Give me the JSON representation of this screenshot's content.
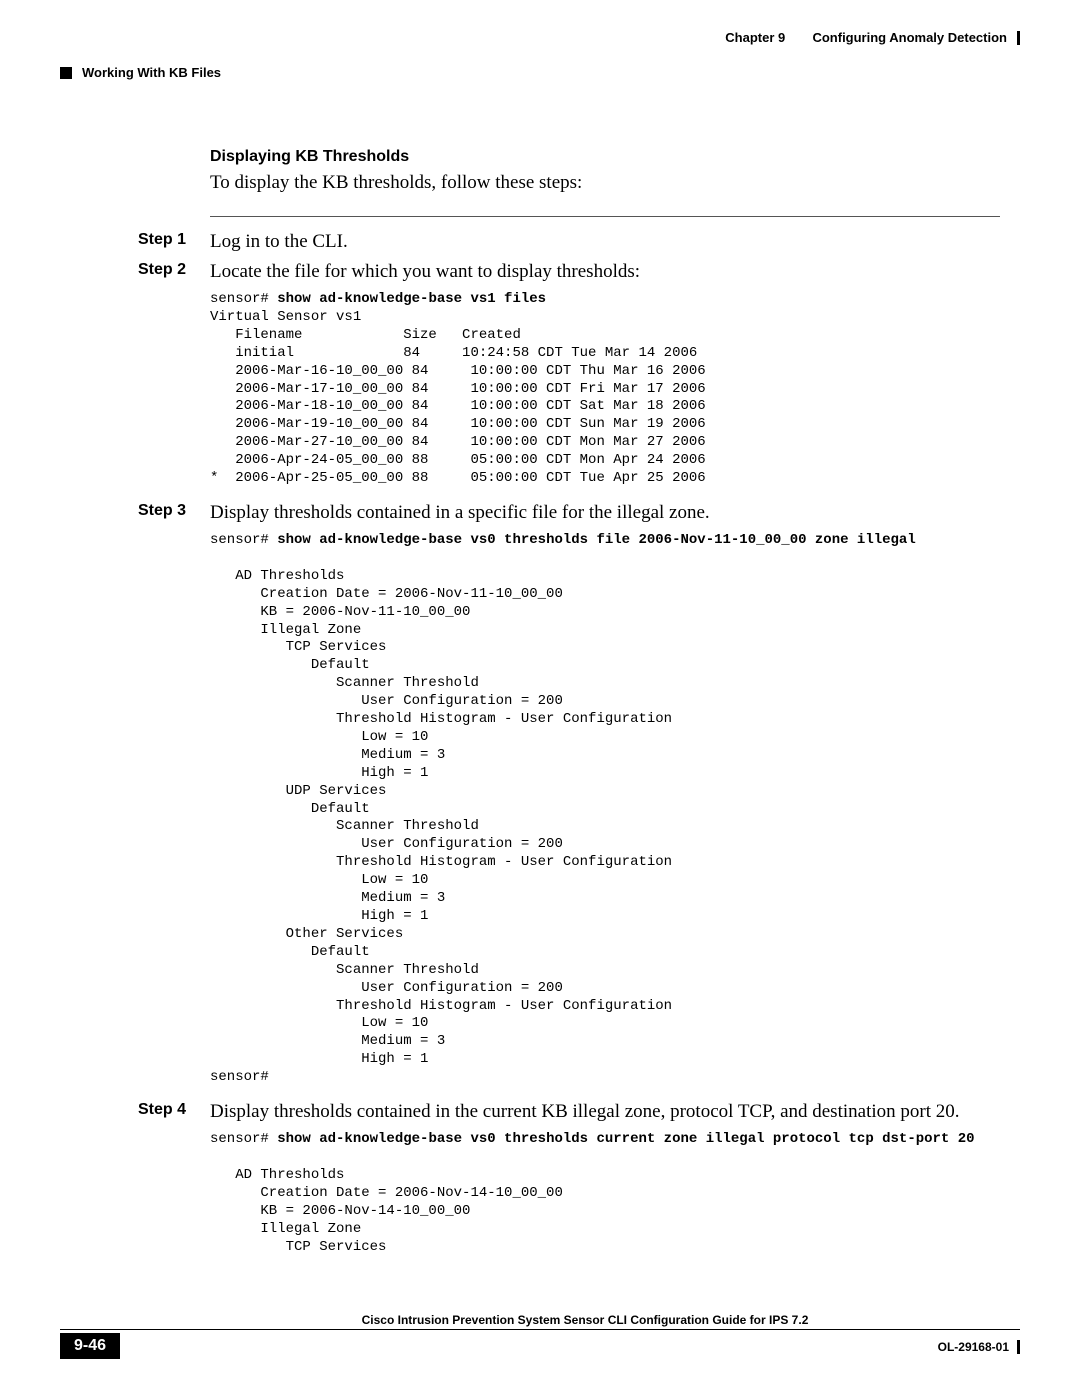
{
  "header": {
    "chapter": "Chapter 9",
    "chapterTitle": "Configuring Anomaly Detection",
    "section": "Working With KB Files"
  },
  "section": {
    "heading": "Displaying KB Thresholds",
    "intro": "To display the KB thresholds, follow these steps:"
  },
  "steps": {
    "s1": {
      "label": "Step 1",
      "text": "Log in to the CLI."
    },
    "s2": {
      "label": "Step 2",
      "text": "Locate the file for which you want to display thresholds:"
    },
    "s3": {
      "label": "Step 3",
      "text": "Display thresholds contained in a specific file for the illegal zone."
    },
    "s4": {
      "label": "Step 4",
      "text": "Display thresholds contained in the current KB illegal zone, protocol TCP, and destination port 20."
    }
  },
  "code": {
    "c2cmd": "show ad-knowledge-base vs1 files",
    "c2out": "Virtual Sensor vs1\n   Filename            Size   Created\n   initial             84     10:24:58 CDT Tue Mar 14 2006\n   2006-Mar-16-10_00_00 84     10:00:00 CDT Thu Mar 16 2006\n   2006-Mar-17-10_00_00 84     10:00:00 CDT Fri Mar 17 2006\n   2006-Mar-18-10_00_00 84     10:00:00 CDT Sat Mar 18 2006\n   2006-Mar-19-10_00_00 84     10:00:00 CDT Sun Mar 19 2006\n   2006-Mar-27-10_00_00 84     10:00:00 CDT Mon Mar 27 2006\n   2006-Apr-24-05_00_00 88     05:00:00 CDT Mon Apr 24 2006\n*  2006-Apr-25-05_00_00 88     05:00:00 CDT Tue Apr 25 2006",
    "c3cmd": "show ad-knowledge-base vs0 thresholds file 2006-Nov-11-10_00_00 zone illegal",
    "c3out": "   AD Thresholds\n      Creation Date = 2006-Nov-11-10_00_00\n      KB = 2006-Nov-11-10_00_00\n      Illegal Zone\n         TCP Services\n            Default\n               Scanner Threshold\n                  User Configuration = 200\n               Threshold Histogram - User Configuration\n                  Low = 10\n                  Medium = 3\n                  High = 1\n         UDP Services\n            Default\n               Scanner Threshold\n                  User Configuration = 200\n               Threshold Histogram - User Configuration\n                  Low = 10\n                  Medium = 3\n                  High = 1\n         Other Services\n            Default\n               Scanner Threshold\n                  User Configuration = 200\n               Threshold Histogram - User Configuration\n                  Low = 10\n                  Medium = 3\n                  High = 1\nsensor#",
    "c4cmd": "show ad-knowledge-base vs0 thresholds current zone illegal protocol tcp dst-port 20",
    "c4out": "   AD Thresholds\n      Creation Date = 2006-Nov-14-10_00_00\n      KB = 2006-Nov-14-10_00_00\n      Illegal Zone\n         TCP Services",
    "prompt": "sensor# "
  },
  "footer": {
    "title": "Cisco Intrusion Prevention System Sensor CLI Configuration Guide for IPS 7.2",
    "page": "9-46",
    "docid": "OL-29168-01"
  }
}
